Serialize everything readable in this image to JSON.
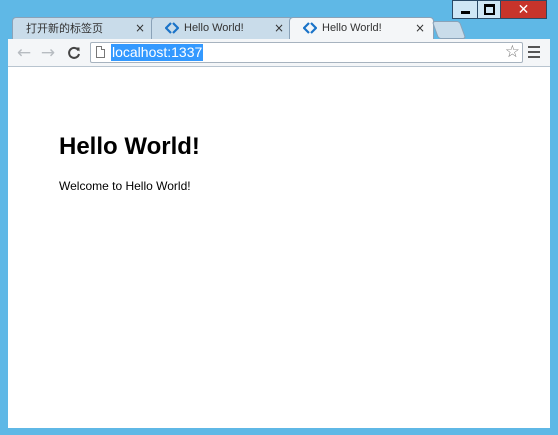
{
  "window": {
    "controls": {
      "minimize_icon": "minimize-icon",
      "maximize_icon": "maximize-icon",
      "close_label": "✕"
    }
  },
  "tabs": [
    {
      "title": "打开新的标签页",
      "close": "×",
      "active": false,
      "favicon": "none"
    },
    {
      "title": "Hello World!",
      "close": "×",
      "active": false,
      "favicon": "blue-chevron-icon"
    },
    {
      "title": "Hello World!",
      "close": "×",
      "active": true,
      "favicon": "blue-chevron-icon"
    }
  ],
  "toolbar": {
    "back_label": "←",
    "forward_label": "→",
    "reload_label": "C",
    "url": "localhost:1337",
    "star_label": "☆"
  },
  "page": {
    "heading": "Hello World!",
    "text": "Welcome to Hello World!"
  },
  "colors": {
    "frame": "#5fb8e6",
    "selection": "#3399ff",
    "close_button": "#c7342b"
  }
}
